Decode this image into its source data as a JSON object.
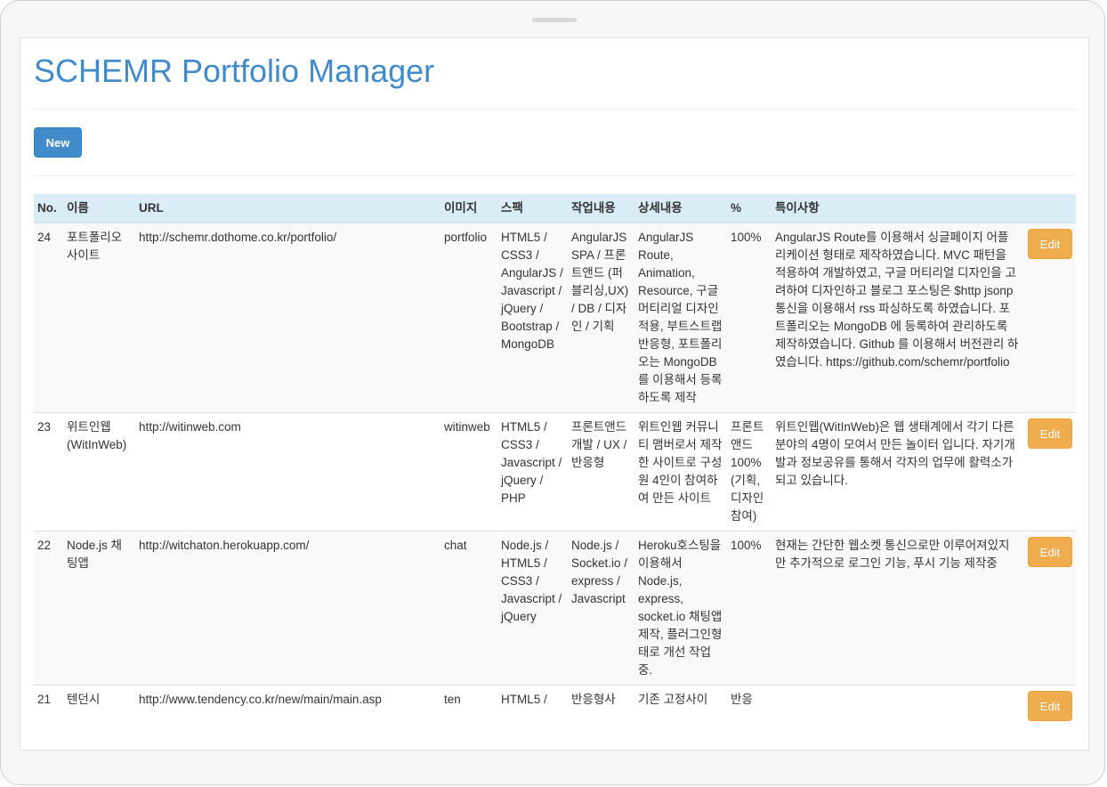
{
  "app": {
    "title": "SCHEMR Portfolio Manager"
  },
  "toolbar": {
    "new_label": "New"
  },
  "table": {
    "columns": [
      "No.",
      "이름",
      "URL",
      "이미지",
      "스팩",
      "작업내용",
      "상세내용",
      "%",
      "특이사항"
    ],
    "edit_label": "Edit",
    "rows": [
      {
        "no": "24",
        "name": "포트폴리오 사이트",
        "url": "http://schemr.dothome.co.kr/portfolio/",
        "image": "portfolio",
        "spec": "HTML5 / CSS3 / AngularJS / Javascript / jQuery / Bootstrap / MongoDB",
        "work": "AngularJS SPA / 프론트앤드 (퍼블리싱,UX) / DB / 디자인 / 기획",
        "detail": "AngularJS Route, Animation, Resource, 구글 머티리얼 디자인 적용, 부트스트랩 반응형, 포트폴리오는 MongoDB 를 이용해서 등록하도록 제작",
        "percent": "100%",
        "note": "AngularJS Route를 이용해서 싱글페이지 어플리케이션 형태로 제작하였습니다. MVC 패턴을 적용하여 개발하였고, 구글 머티리얼 디자인을 고려하여 디자인하고 블로그 포스팅은 $http jsonp 통신을 이용해서 rss 파싱하도록 하였습니다. 포트폴리오는 MongoDB 에 등록하여 관리하도록 제작하였습니다. Github 를 이용해서 버전관리 하였습니다. https://github.com/schemr/portfolio"
      },
      {
        "no": "23",
        "name": "위트인웹(WitInWeb)",
        "url": "http://witinweb.com",
        "image": "witinweb",
        "spec": "HTML5 / CSS3 / Javascript / jQuery / PHP",
        "work": "프론트앤드 개발 / UX / 반응형",
        "detail": "위트인웹 커뮤니티 맴버로서 제작한 사이트로 구성원 4인이 참여하여 만든 사이트",
        "percent": "프론트앤드 100%(기획, 디자인 참여)",
        "note": "위트인웹(WitInWeb)은 웹 생태계에서 각기 다른 분야의 4명이 모여서 만든 놀이터 입니다. 자기개발과 정보공유를 통해서 각자의 업무에 활력소가 되고 있습니다."
      },
      {
        "no": "22",
        "name": "Node.js 채팅앱",
        "url": "http://witchaton.herokuapp.com/",
        "image": "chat",
        "spec": "Node.js / HTML5 / CSS3 / Javascript / jQuery",
        "work": "Node.js / Socket.io / express / Javascript",
        "detail": "Heroku호스팅을 이용해서 Node.js, express, socket.io 채팅앱 제작, 플러그인형태로 개선 작업중.",
        "percent": "100%",
        "note": "현재는 간단한 웹소켓 통신으로만 이루어져있지만 추가적으로 로그인 기능, 푸시 기능 제작중"
      },
      {
        "no": "21",
        "name": "텐던시",
        "url": "http://www.tendency.co.kr/new/main/main.asp",
        "image": "ten",
        "spec": "HTML5 /",
        "work": "반응형사",
        "detail": "기존 고정사이",
        "percent": "반응",
        "note": ""
      }
    ]
  }
}
